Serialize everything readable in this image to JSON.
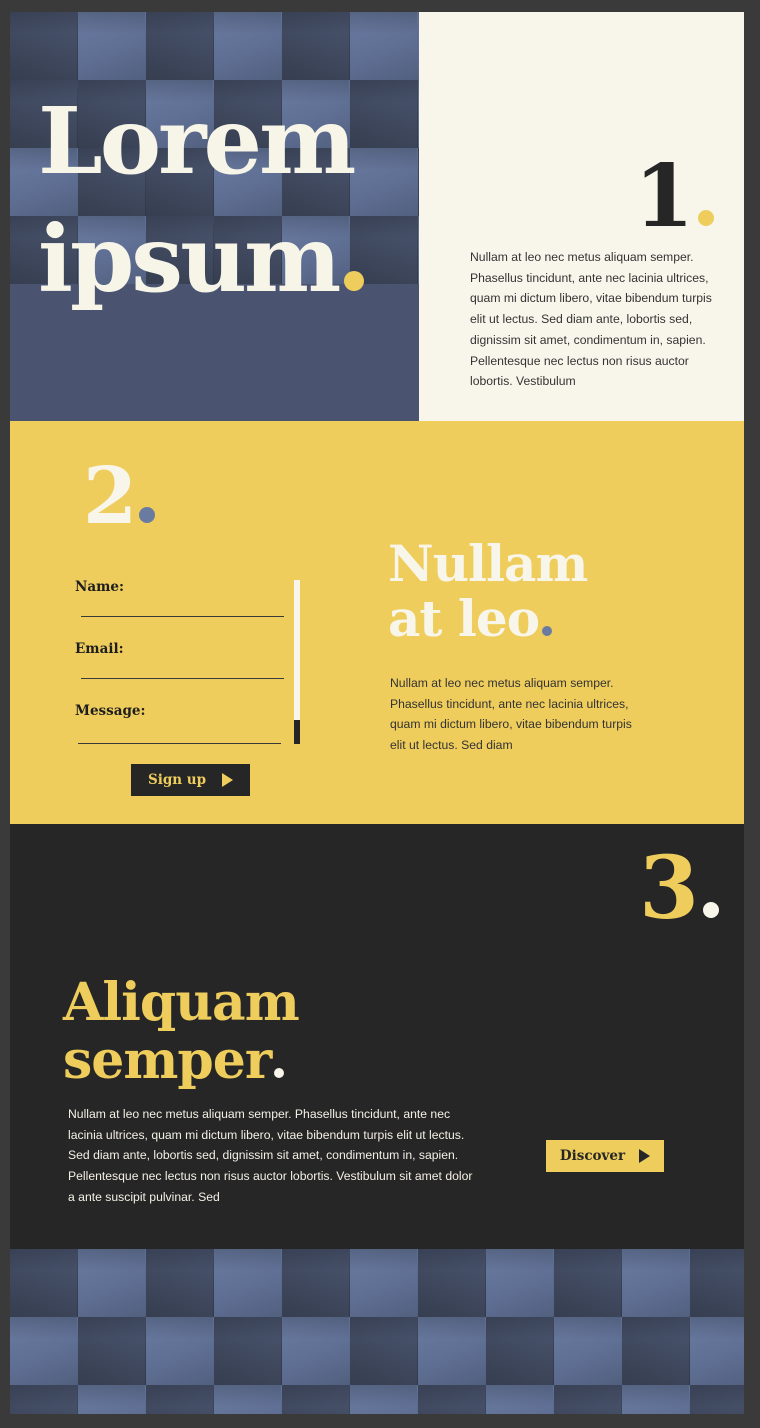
{
  "colors": {
    "yellow": "#efcd5c",
    "cream": "#f8f6eb",
    "charcoal": "#262626",
    "slate": "#4a5470",
    "slate_light": "#6a7ba1"
  },
  "hero": {
    "title_line1": "Lorem",
    "title_line2": "ipsum",
    "dot_color": "#efcd5c"
  },
  "section1": {
    "number": "1",
    "dot_color": "#efcd5c",
    "text": "Nullam at leo nec metus aliquam semper. Phasellus tincidunt, ante nec lacinia ultrices, quam mi dictum libero, vitae bibendum turpis elit ut lectus. Sed diam ante, lobortis sed, dignissim sit amet, condimentum in, sapien. Pellentesque nec lectus non risus auctor lobortis. Vestibulum"
  },
  "section2": {
    "number": "2",
    "dot_color": "#6a7ba1",
    "form": {
      "name_label": "Name:",
      "email_label": "Email:",
      "message_label": "Message:",
      "name_value": "",
      "email_value": "",
      "message_value": "",
      "submit_label": "Sign up"
    },
    "title_line1": "Nullam",
    "title_line2": "at leo",
    "text": "Nullam at leo nec metus aliquam semper. Phasellus tincidunt, ante nec lacinia ultrices, quam mi dictum libero, vitae bibendum turpis elit ut lectus. Sed diam"
  },
  "section3": {
    "number": "3",
    "dot_color": "#f8f6eb",
    "title_line1": "Aliquam",
    "title_line2": "semper",
    "text": "Nullam at leo nec metus aliquam semper. Phasellus tincidunt, ante nec lacinia ultrices, quam mi dictum libero, vitae bibendum turpis elit ut lectus. Sed diam ante, lobortis sed, dignissim sit amet, condimentum in, sapien. Pellentesque nec lectus non risus auctor lobortis. Vestibulum sit amet dolor a ante suscipit pulvinar. Sed",
    "button_label": "Discover"
  },
  "icons": {
    "signup_arrow": "arrow-right-icon",
    "discover_arrow": "arrow-right-icon"
  }
}
